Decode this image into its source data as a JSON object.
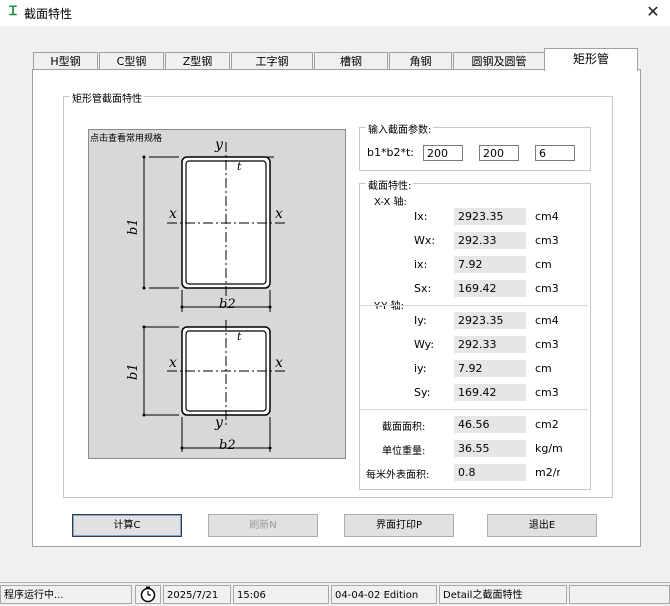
{
  "window": {
    "title": "截面特性",
    "close": "✕"
  },
  "tabs": [
    {
      "label": "H型钢"
    },
    {
      "label": "C型钢"
    },
    {
      "label": "Z型钢"
    },
    {
      "label": "工字钢"
    },
    {
      "label": "槽钢"
    },
    {
      "label": "角钢"
    },
    {
      "label": "圆钢及圆管"
    },
    {
      "label": "矩形管"
    }
  ],
  "section": {
    "title": "矩形管截面特性",
    "drawing_hint": "点击查看常用规格",
    "drawing_labels": {
      "y": "y",
      "x": "x",
      "t": "t",
      "b1": "b1",
      "b2": "b2"
    },
    "input_group": "输入截面参数:",
    "input_label": "b1*b2*t:",
    "inputs": [
      "200",
      "200",
      "6"
    ],
    "props_group": "截面特性:",
    "xx_label": "X-X 轴:",
    "yy_label": "Y-Y 轴:",
    "xx": [
      {
        "label": "Ix:",
        "value": "2923.35",
        "unit": "cm4"
      },
      {
        "label": "Wx:",
        "value": "292.33",
        "unit": "cm3"
      },
      {
        "label": "ix:",
        "value": "7.92",
        "unit": "cm"
      },
      {
        "label": "Sx:",
        "value": "169.42",
        "unit": "cm3"
      }
    ],
    "yy": [
      {
        "label": "Iy:",
        "value": "2923.35",
        "unit": "cm4"
      },
      {
        "label": "Wy:",
        "value": "292.33",
        "unit": "cm3"
      },
      {
        "label": "iy:",
        "value": "7.92",
        "unit": "cm"
      },
      {
        "label": "Sy:",
        "value": "169.42",
        "unit": "cm3"
      }
    ],
    "extra": [
      {
        "label": "截面面积:",
        "value": "46.56",
        "unit": "cm2"
      },
      {
        "label": "单位重量:",
        "value": "36.55",
        "unit": "kg/m"
      },
      {
        "label": "每米外表面积:",
        "value": "0.8",
        "unit": "m2/m"
      }
    ]
  },
  "buttons": {
    "calc": "计算C",
    "refresh": "刷新N",
    "print": "界面打印P",
    "exit": "退出E"
  },
  "status": {
    "state": "程序运行中...",
    "clock_icon": "clock-icon",
    "date": "2025/7/21",
    "time": "15:06",
    "edition": "04-04-02 Edition",
    "module": "Detail之截面特性"
  }
}
